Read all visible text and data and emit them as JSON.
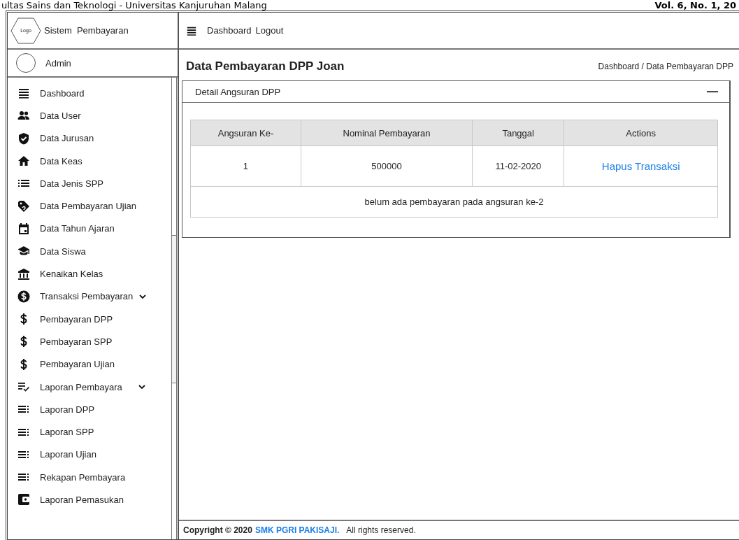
{
  "page_header": {
    "left": "ultas Sains dan Teknologi - Universitas Kanjuruhan Malang",
    "right": "Vol. 6, No. 1, 20"
  },
  "brand": {
    "logo": "Logo",
    "title": "Sistem  Pembayaran"
  },
  "user": {
    "name": "Admin"
  },
  "topbar": {
    "links": [
      "Dashboard",
      "Logout"
    ]
  },
  "sidebar": {
    "items": [
      {
        "label": "Dashboard",
        "kind": "menu"
      },
      {
        "label": "Data User",
        "kind": "users"
      },
      {
        "label": "Data Jurusan",
        "kind": "shield"
      },
      {
        "label": "Data Keas",
        "kind": "home"
      },
      {
        "label": "Data Jenis SPP",
        "kind": "list"
      },
      {
        "label": "Data Pembayaran Ujian",
        "kind": "tag"
      },
      {
        "label": "Data Tahun Ajaran",
        "kind": "calendar"
      },
      {
        "label": "Data Siswa",
        "kind": "school"
      },
      {
        "label": "Kenaikan Kelas",
        "kind": "bank"
      },
      {
        "label": "Transaksi Pembayaran",
        "kind": "money",
        "expanded": true,
        "children": [
          {
            "label": "Pembayaran DPP",
            "kind": "dollar"
          },
          {
            "label": "Pembayaran SPP",
            "kind": "dollar"
          },
          {
            "label": "Pembayaran Ujian",
            "kind": "dollar"
          }
        ]
      },
      {
        "label": "Laporan Pembayara",
        "kind": "check",
        "expanded": true,
        "children": [
          {
            "label": "Laporan DPP",
            "kind": "report"
          },
          {
            "label": "Laporan SPP",
            "kind": "report"
          },
          {
            "label": "Laporan Ujian",
            "kind": "report"
          },
          {
            "label": "Rekapan Pembayara",
            "kind": "report"
          }
        ]
      },
      {
        "label": "Laporan Pemasukan",
        "kind": "wallet"
      }
    ]
  },
  "page": {
    "title": "Data Pembayaran DPP Joan",
    "breadcrumb": "Dashboard / Data Pembayaran DPP"
  },
  "panel": {
    "title": "Detail Angsuran DPP",
    "collapse": "—",
    "table": {
      "columns": [
        "Angsuran Ke-",
        "Nominal Pembayaran",
        "Tanggal",
        "Actions"
      ],
      "rows": [
        {
          "cells": [
            "1",
            "500000",
            "11-02-2020"
          ],
          "action": "Hapus Transaksi"
        }
      ],
      "message": "belum ada pembayaran pada angsuran ke-2"
    }
  },
  "footer": {
    "copyright": "Copyright © 2020",
    "owner": "SMK PGRI PAKISAJI.",
    "rights": "All rights reserved."
  }
}
